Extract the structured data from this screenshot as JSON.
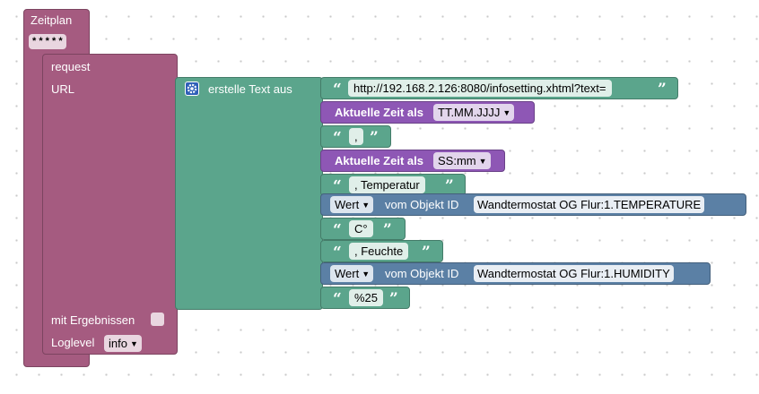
{
  "schedule": {
    "label": "Zeitplan",
    "value": "* * * * *"
  },
  "request": {
    "label": "request",
    "url_label": "URL",
    "results_label": "mit Ergebnissen",
    "loglevel_label": "Loglevel",
    "loglevel_value": "info"
  },
  "textjoin": {
    "label": "erstelle Text aus"
  },
  "items": {
    "url_text": "http://192.168.2.126:8080/infosetting.xhtml?text=",
    "time1_label": "Aktuelle Zeit als",
    "time1_format": "TT.MM.JJJJ",
    "comma_text": ",",
    "time2_label": "Aktuelle Zeit als",
    "time2_format": "SS:mm",
    "temp_text": ", Temperatur",
    "obj1_value": "Wert",
    "obj1_label": "vom Objekt ID",
    "obj1_id": "Wandtermostat OG Flur:1.TEMPERATURE",
    "deg_text": "C°",
    "hum_text": ", Feuchte",
    "obj2_value": "Wert",
    "obj2_label": "vom Objekt ID",
    "obj2_id": "Wandtermostat OG Flur:1.HUMIDITY",
    "pct_text": "%25"
  },
  "colors": {
    "schedule": "#a55b80",
    "text": "#5ba58c",
    "time": "#8e57b5",
    "object": "#5b80a5"
  }
}
